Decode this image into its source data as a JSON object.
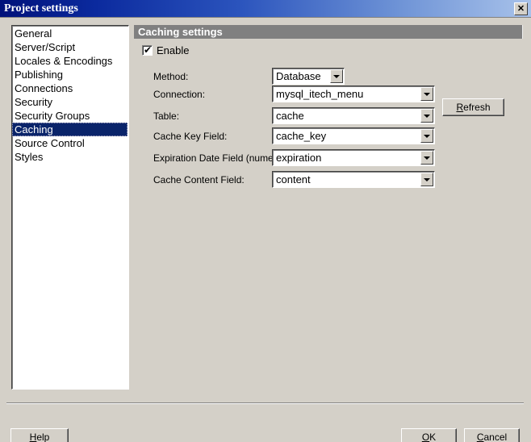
{
  "window": {
    "title": "Project settings",
    "close_icon": "close-icon",
    "close_glyph": "✕"
  },
  "sidebar": {
    "items": [
      {
        "label": "General",
        "selected": false
      },
      {
        "label": "Server/Script",
        "selected": false
      },
      {
        "label": "Locales & Encodings",
        "selected": false
      },
      {
        "label": "Publishing",
        "selected": false
      },
      {
        "label": "Connections",
        "selected": false
      },
      {
        "label": "Security",
        "selected": false
      },
      {
        "label": "Security Groups",
        "selected": false
      },
      {
        "label": "Caching",
        "selected": true
      },
      {
        "label": "Source Control",
        "selected": false
      },
      {
        "label": "Styles",
        "selected": false
      }
    ]
  },
  "panel": {
    "header": "Caching settings",
    "enable": {
      "label": "Enable",
      "checked": true,
      "check_glyph": "✔"
    },
    "fields": [
      {
        "label": "Method:",
        "value": "Database"
      },
      {
        "label": "Connection:",
        "value": "mysql_itech_menu"
      },
      {
        "label": "Table:",
        "value": "cache"
      },
      {
        "label": "Cache Key Field:",
        "value": "cache_key"
      },
      {
        "label": "Expiration Date Field (numeric):",
        "value": "expiration"
      },
      {
        "label": "Cache Content Field:",
        "value": "content"
      }
    ],
    "refresh_button": {
      "accel": "R",
      "rest": "efresh"
    }
  },
  "footer": {
    "help_button": {
      "accel": "H",
      "rest": "elp"
    },
    "ok_button": {
      "accel": "O",
      "rest": "K"
    },
    "cancel_button": {
      "accel": "C",
      "rest": "ancel"
    }
  },
  "colors": {
    "face": "#d4d0c8",
    "titlebar_start": "#00117a",
    "titlebar_end": "#a8c2ea",
    "selection": "#0a246a",
    "header_bar": "#808080"
  }
}
